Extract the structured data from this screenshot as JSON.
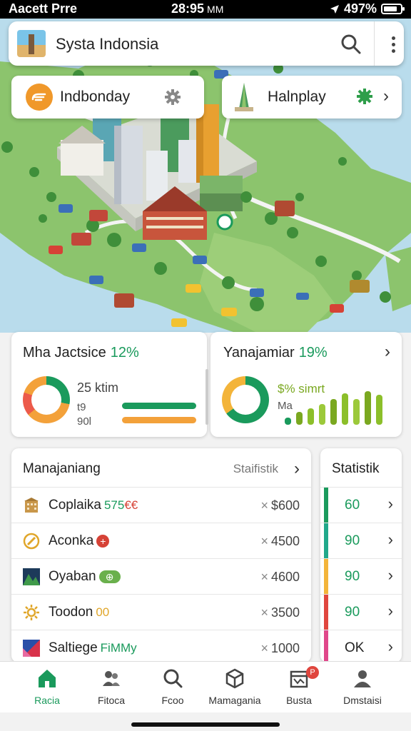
{
  "status_bar": {
    "carrier": "Aacett Prre",
    "time": "28:95",
    "time_suffix": "MM",
    "battery": "497%"
  },
  "search": {
    "title": "Systa Indonsia",
    "search_icon": "search-icon",
    "more_icon": "more-vertical-icon"
  },
  "chips": [
    {
      "label": "Indbonday",
      "icon": "cloud-badge-icon",
      "action_icon": "gear-icon"
    },
    {
      "label": "Halnplay",
      "icon": "tower-icon",
      "action_icon": "green-gear-icon"
    }
  ],
  "stats": {
    "left": {
      "title": "Mha Jactsice",
      "percent": "12%",
      "main_value": "25 ktim",
      "sub1": "t9",
      "sub2": "90l",
      "bar1_color": "#1a9a5c",
      "bar2_color": "#f3a13a"
    },
    "right": {
      "title": "Yanajamiar",
      "percent": "19%",
      "label": "$% simrt",
      "sub": "Ma",
      "bars": [
        0.2,
        0.35,
        0.45,
        0.55,
        0.7,
        0.85,
        0.7,
        0.9,
        0.8
      ]
    }
  },
  "list": {
    "title": "Manajaniang",
    "action": "Staifistik",
    "rows": [
      {
        "name": "Coplaika",
        "tag": "575",
        "tag_extra": "€€",
        "price": "$600",
        "icon": "building-icon"
      },
      {
        "name": "Aconka",
        "tag": "",
        "tag_extra": "+",
        "price": "4500",
        "icon": "compass-icon"
      },
      {
        "name": "Oyaban",
        "tag": "",
        "tag_extra": "⊕",
        "price": "4600",
        "icon": "mountain-icon"
      },
      {
        "name": "Toodon",
        "tag": "00",
        "tag_extra": "",
        "price": "3500",
        "icon": "sun-icon"
      },
      {
        "name": "Saltiege",
        "tag": "FiMMy",
        "tag_extra": "",
        "price": "1000",
        "icon": "flag-icon"
      }
    ]
  },
  "stat_column": {
    "title": "Statistik",
    "values": [
      {
        "value": "60",
        "color": "#1a9a5c"
      },
      {
        "value": "90",
        "color": "#20a88a"
      },
      {
        "value": "90",
        "color": "#f3b43a"
      },
      {
        "value": "90",
        "color": "#e0463e"
      },
      {
        "value": "OK",
        "color": "#e0478a"
      }
    ]
  },
  "nav": [
    {
      "label": "Racia",
      "icon": "home-icon"
    },
    {
      "label": "Fitoca",
      "icon": "people-icon"
    },
    {
      "label": "Fcoo",
      "icon": "search-icon"
    },
    {
      "label": "Mamagania",
      "icon": "cube-icon"
    },
    {
      "label": "Busta",
      "icon": "calendar-icon",
      "badge": "P"
    },
    {
      "label": "Dmstaisi",
      "icon": "profile-icon"
    }
  ],
  "colors": {
    "accent": "#1a9a5c",
    "orange": "#f3a13a",
    "sea": "#b9dcec",
    "land": "#8cc46d"
  }
}
